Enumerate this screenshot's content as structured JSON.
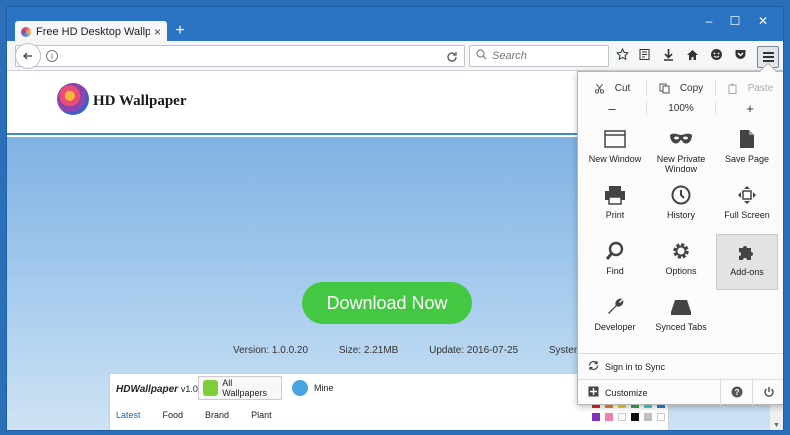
{
  "browser": {
    "tab_title": "Free HD Desktop Wallpap...",
    "tab_close": "×",
    "new_tab": "+",
    "controls": {
      "minimize": "–",
      "maximize": "☐",
      "close": "✕"
    },
    "search_placeholder": "Search"
  },
  "site": {
    "logo_text": "HD Wallpaper",
    "download_label": "Download Now",
    "meta": {
      "version": "Version: 1.0.0.20",
      "size": "Size: 2.21MB",
      "update": "Update: 2016-07-25",
      "system": "System: XP / Vista / Wi"
    },
    "app": {
      "brand": "HDWallpaper",
      "version": "v1.0",
      "tab_all": "All Wallpapers",
      "tab_mine": "Mine",
      "categories": [
        "Latest",
        "Food",
        "Brand",
        "Plant"
      ],
      "swatch_colors": [
        "#e02020",
        "#f0801a",
        "#f5d020",
        "#30b040",
        "#40d0d0",
        "#2080e0",
        "#8030c0",
        "#f080b0",
        "#ffffff",
        "#101010",
        "#c0c0c0",
        "#ffffff"
      ]
    }
  },
  "menu": {
    "cut": "Cut",
    "copy": "Copy",
    "paste": "Paste",
    "zoom_out": "–",
    "zoom_level": "100%",
    "zoom_in": "+",
    "items": [
      {
        "label": "New Window",
        "icon": "window-icon"
      },
      {
        "label": "New Private Window",
        "icon": "mask-icon"
      },
      {
        "label": "Save Page",
        "icon": "page-icon"
      },
      {
        "label": "Print",
        "icon": "printer-icon"
      },
      {
        "label": "History",
        "icon": "clock-icon"
      },
      {
        "label": "Full Screen",
        "icon": "fullscreen-icon"
      },
      {
        "label": "Find",
        "icon": "search-icon"
      },
      {
        "label": "Options",
        "icon": "gear-icon"
      },
      {
        "label": "Add-ons",
        "icon": "puzzle-icon"
      },
      {
        "label": "Developer",
        "icon": "wrench-icon"
      },
      {
        "label": "Synced Tabs",
        "icon": "synced-tabs-icon"
      }
    ],
    "sign_in": "Sign in to Sync",
    "customize": "Customize"
  }
}
